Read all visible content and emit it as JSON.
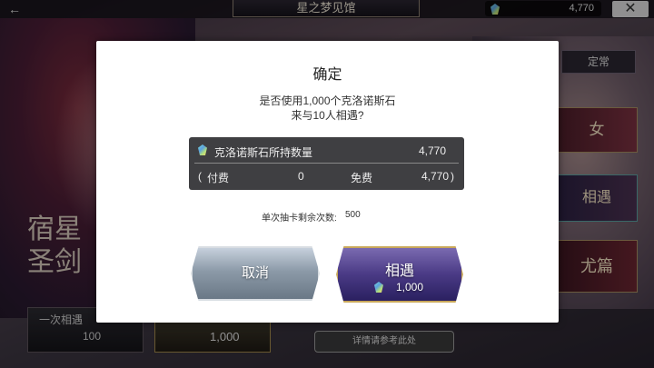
{
  "header": {
    "back_glyph": "←",
    "title": "星之梦见馆",
    "currency_amount": "4,770",
    "close_glyph": "✕"
  },
  "background": {
    "tab_regular": "定常",
    "banner_1": "女",
    "banner_2": "相遇",
    "banner_3": "尤篇",
    "left_title": "宿星\n圣剑",
    "draw_single_label": "一次相遇",
    "draw_single_cost": "100",
    "draw_ten_cost": "1,000",
    "details_button": "详情请参考此处"
  },
  "dialog": {
    "title": "确定",
    "message_line1": "是否使用1,000个克洛诺斯石",
    "message_line2": "来与10人相遇?",
    "stones": {
      "label": "克洛诺斯石所持数量",
      "total": "4,770",
      "open_paren": "(",
      "paid_label": "付费",
      "paid_value": "0",
      "free_label": "免费",
      "free_value": "4,770",
      "close_paren": ")"
    },
    "remaining_label": "单次抽卡剩余次数:",
    "remaining_value": "500",
    "cancel_label": "取消",
    "confirm_label": "相遇",
    "confirm_cost": "1,000"
  },
  "icons": {
    "gem": "chronos-stone-icon"
  }
}
